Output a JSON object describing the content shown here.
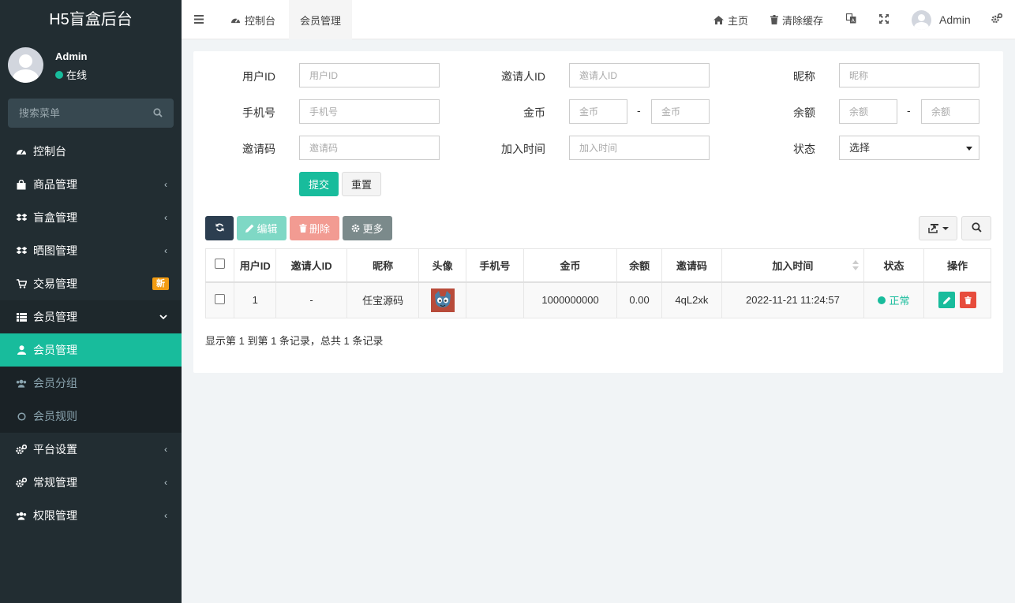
{
  "brand": "H5盲盒后台",
  "user": {
    "name": "Admin",
    "status": "在线"
  },
  "sidebar_search": {
    "placeholder": "搜索菜单"
  },
  "menu": [
    {
      "label": "控制台",
      "icon": "dashboard-icon"
    },
    {
      "label": "商品管理",
      "icon": "shopping-bag-icon"
    },
    {
      "label": "盲盒管理",
      "icon": "dropbox-icon"
    },
    {
      "label": "晒图管理",
      "icon": "dropbox-icon"
    },
    {
      "label": "交易管理",
      "icon": "cart-icon",
      "badge": "新"
    },
    {
      "label": "会员管理",
      "icon": "list-icon"
    },
    {
      "label": "会员管理",
      "icon": "user-icon"
    },
    {
      "label": "会员分组",
      "icon": "users-icon"
    },
    {
      "label": "会员规则",
      "icon": "circle-icon"
    },
    {
      "label": "平台设置",
      "icon": "cogs-icon"
    },
    {
      "label": "常规管理",
      "icon": "cogs-icon"
    },
    {
      "label": "权限管理",
      "icon": "users-icon"
    }
  ],
  "topbar": {
    "tabs": [
      "控制台",
      "会员管理"
    ],
    "home": "主页",
    "clear_cache": "清除缓存",
    "admin": "Admin"
  },
  "filters": {
    "user_id": {
      "label": "用户ID",
      "placeholder": "用户ID"
    },
    "inviter_id": {
      "label": "邀请人ID",
      "placeholder": "邀请人ID"
    },
    "nickname": {
      "label": "昵称",
      "placeholder": "昵称"
    },
    "mobile": {
      "label": "手机号",
      "placeholder": "手机号"
    },
    "coin": {
      "label": "金币",
      "placeholder": "金币",
      "sep": "-"
    },
    "balance": {
      "label": "余额",
      "placeholder": "余额",
      "sep": "-"
    },
    "invite_code": {
      "label": "邀请码",
      "placeholder": "邀请码"
    },
    "join_time": {
      "label": "加入时间",
      "placeholder": "加入时间"
    },
    "status": {
      "label": "状态",
      "value": "选择"
    },
    "submit": "提交",
    "reset": "重置"
  },
  "toolbar": {
    "edit": "编辑",
    "delete": "删除",
    "more": "更多"
  },
  "table": {
    "columns": [
      "用户ID",
      "邀请人ID",
      "昵称",
      "头像",
      "手机号",
      "金币",
      "余额",
      "邀请码",
      "加入时间",
      "状态",
      "操作"
    ],
    "rows": [
      {
        "id": "1",
        "inviter": "-",
        "nickname": "任宝源码",
        "mobile": "",
        "coin": "1000000000",
        "balance": "0.00",
        "code": "4qL2xk",
        "time": "2022-11-21 11:24:57",
        "status": "正常"
      }
    ]
  },
  "footer": "显示第 1 到第 1 条记录，总共 1 条记录",
  "colors": {
    "accent": "#18bc9c",
    "sidebar": "#222d32",
    "danger": "#e74c3c",
    "badge": "#f39c12"
  }
}
